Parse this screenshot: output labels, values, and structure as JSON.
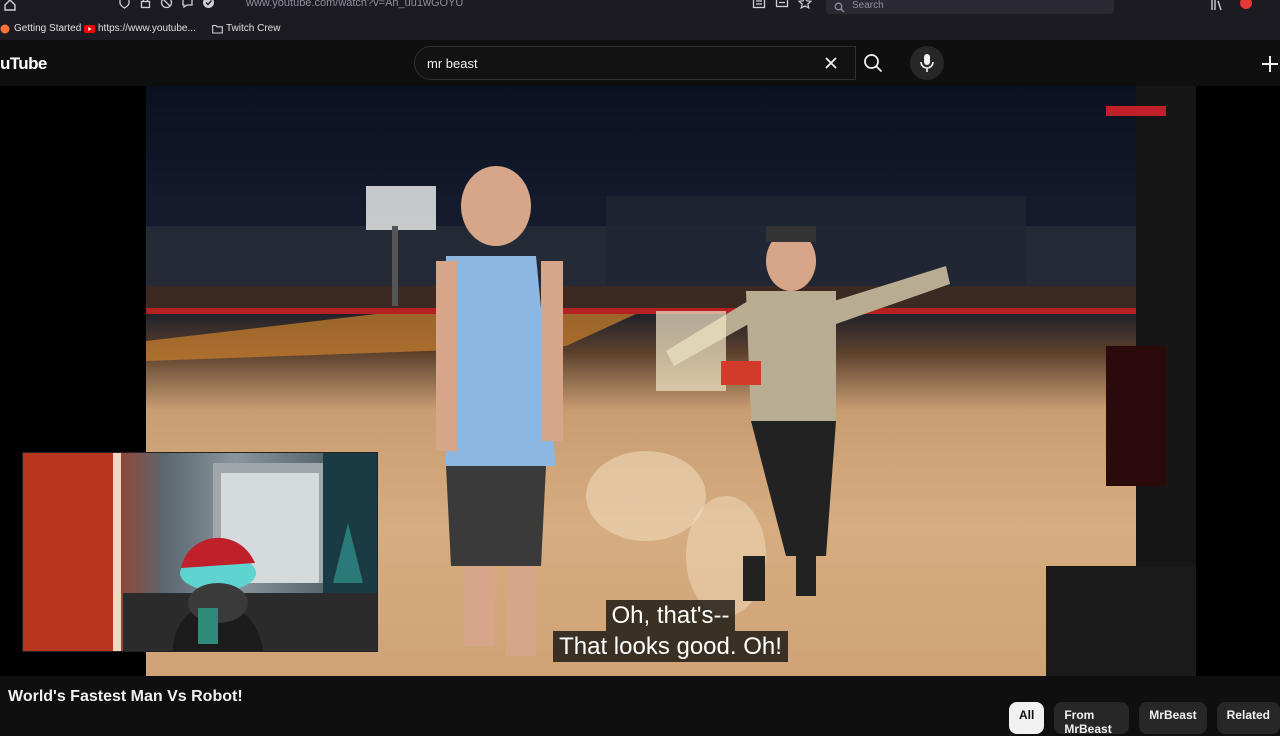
{
  "browser": {
    "url": "www.youtube.com/watch?v=Ah_uu1wGOYU",
    "search_placeholder": "Search",
    "bookmarks": [
      {
        "label": "Getting Started"
      },
      {
        "label": "https://www.youtube..."
      },
      {
        "label": "Twitch Crew"
      }
    ]
  },
  "header": {
    "logo_text": "uTube",
    "search_value": "mr beast"
  },
  "player": {
    "caption_lines": [
      "Oh, that's--",
      "That looks good. Oh!"
    ]
  },
  "video": {
    "title": "World's Fastest Man Vs Robot!"
  },
  "chips": [
    {
      "label": "All",
      "active": true
    },
    {
      "label": "From MrBeast",
      "active": false
    },
    {
      "label": "MrBeast",
      "active": false
    },
    {
      "label": "Related",
      "active": false
    }
  ],
  "colors": {
    "page_bg": "#0f0f0f",
    "chrome_bg": "#1c1b22",
    "youtube_red": "#ff0000"
  }
}
